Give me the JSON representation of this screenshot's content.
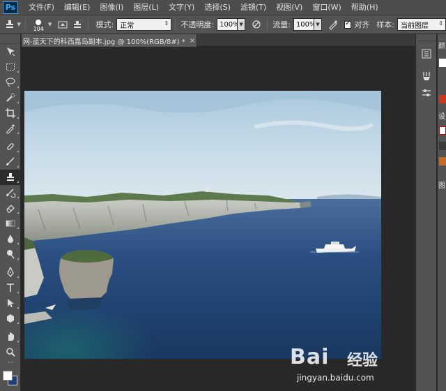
{
  "app": {
    "logo": "Ps"
  },
  "menu": [
    "文件(F)",
    "编辑(E)",
    "图像(I)",
    "图层(L)",
    "文字(Y)",
    "选择(S)",
    "滤镜(T)",
    "视图(V)",
    "窗口(W)",
    "帮助(H)"
  ],
  "options": {
    "brush_size": "104",
    "mode_label": "模式:",
    "mode_value": "正常",
    "opacity_label": "不透明度:",
    "opacity_value": "100%",
    "flow_label": "流量:",
    "flow_value": "100%",
    "align_label": "对齐",
    "sample_label": "样本:",
    "sample_value": "当前图层"
  },
  "document": {
    "tab_title": "网-蓝天下的科西嘉岛副本.jpg @ 100%(RGB/8#) *",
    "close_glyph": "×"
  },
  "colors": {
    "foreground": "#ffffff",
    "background": "#1d3f75"
  },
  "dock2_labels": [
    "颜",
    "设",
    "图"
  ],
  "watermark": {
    "brand": "Bai",
    "brand_suffix": "经验",
    "url": "jingyan.baidu.com"
  }
}
